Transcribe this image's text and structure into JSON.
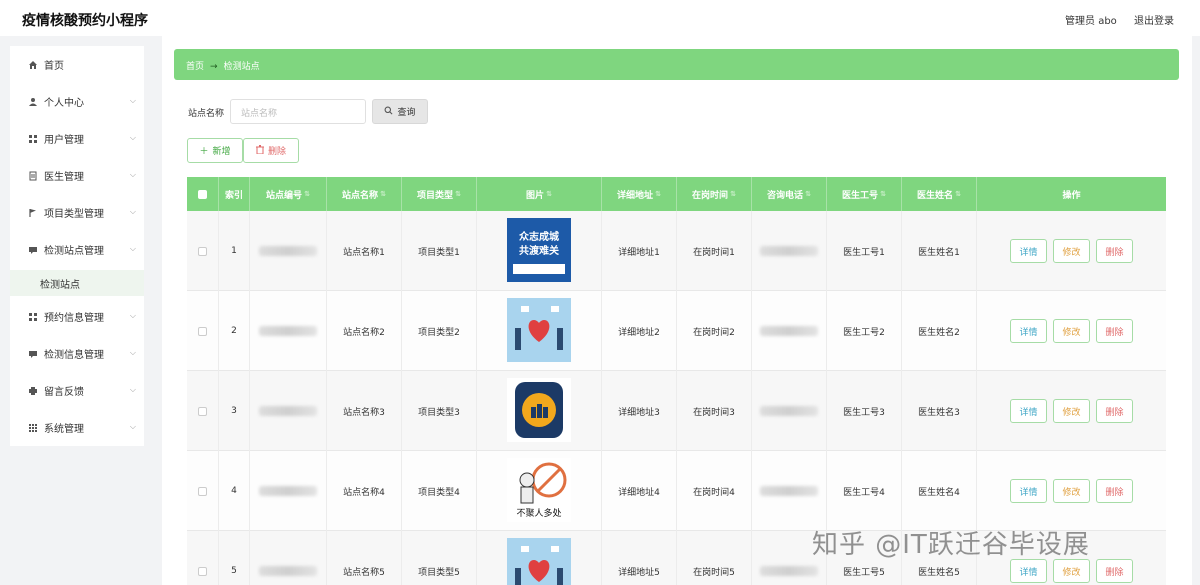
{
  "header": {
    "title": "疫情核酸预约小程序",
    "user": "管理员 abo",
    "logout": "退出登录"
  },
  "sidebar": {
    "items": [
      {
        "label": "首页",
        "icon": "home-icon"
      },
      {
        "label": "个人中心",
        "icon": "user-icon"
      },
      {
        "label": "用户管理",
        "icon": "grid-icon"
      },
      {
        "label": "医生管理",
        "icon": "document-icon"
      },
      {
        "label": "项目类型管理",
        "icon": "flag-icon"
      },
      {
        "label": "检测站点管理",
        "icon": "chat-icon"
      },
      {
        "label": "预约信息管理",
        "icon": "grid-icon"
      },
      {
        "label": "检测信息管理",
        "icon": "chat-icon"
      },
      {
        "label": "留言反馈",
        "icon": "printer-icon"
      },
      {
        "label": "系统管理",
        "icon": "apps-icon"
      }
    ],
    "sub_item": "检测站点"
  },
  "breadcrumb": {
    "home": "首页",
    "current": "检测站点"
  },
  "search": {
    "label": "站点名称",
    "placeholder": "站点名称",
    "button": "查询"
  },
  "actions": {
    "add": "新增",
    "delete": "删除"
  },
  "table": {
    "headers": [
      "索引",
      "站点编号",
      "站点名称",
      "项目类型",
      "图片",
      "详细地址",
      "在岗时间",
      "咨询电话",
      "医生工号",
      "医生姓名",
      "操作"
    ],
    "ops": {
      "detail": "详情",
      "edit": "修改",
      "delete": "删除"
    },
    "rows": [
      {
        "index": "1",
        "name": "站点名称1",
        "type": "项目类型1",
        "image": "poster-blue",
        "address": "详细地址1",
        "time": "在岗时间1",
        "doc_id": "医生工号1",
        "doc_name": "医生姓名1"
      },
      {
        "index": "2",
        "name": "站点名称2",
        "type": "项目类型2",
        "image": "poster-heart",
        "address": "详细地址2",
        "time": "在岗时间2",
        "doc_id": "医生工号2",
        "doc_name": "医生姓名2"
      },
      {
        "index": "3",
        "name": "站点名称3",
        "type": "项目类型3",
        "image": "poster-icon",
        "address": "详细地址3",
        "time": "在岗时间3",
        "doc_id": "医生工号3",
        "doc_name": "医生姓名3"
      },
      {
        "index": "4",
        "name": "站点名称4",
        "type": "项目类型4",
        "image": "poster-nogather",
        "address": "详细地址4",
        "time": "在岗时间4",
        "doc_id": "医生工号4",
        "doc_name": "医生姓名4"
      },
      {
        "index": "5",
        "name": "站点名称5",
        "type": "项目类型5",
        "image": "poster-heart",
        "address": "详细地址5",
        "time": "在岗时间5",
        "doc_id": "医生工号5",
        "doc_name": "医生姓名5"
      }
    ]
  },
  "images": {
    "poster_blue_line1": "众志成城",
    "poster_blue_line2": "共渡难关",
    "poster_nogather_text": "不聚人多处"
  },
  "watermark": "知乎 @IT跃迁谷毕设展",
  "colors": {
    "accent": "#7fd67f",
    "danger": "#e06a6a",
    "info": "#3ea6c6",
    "warn": "#e0a040"
  }
}
